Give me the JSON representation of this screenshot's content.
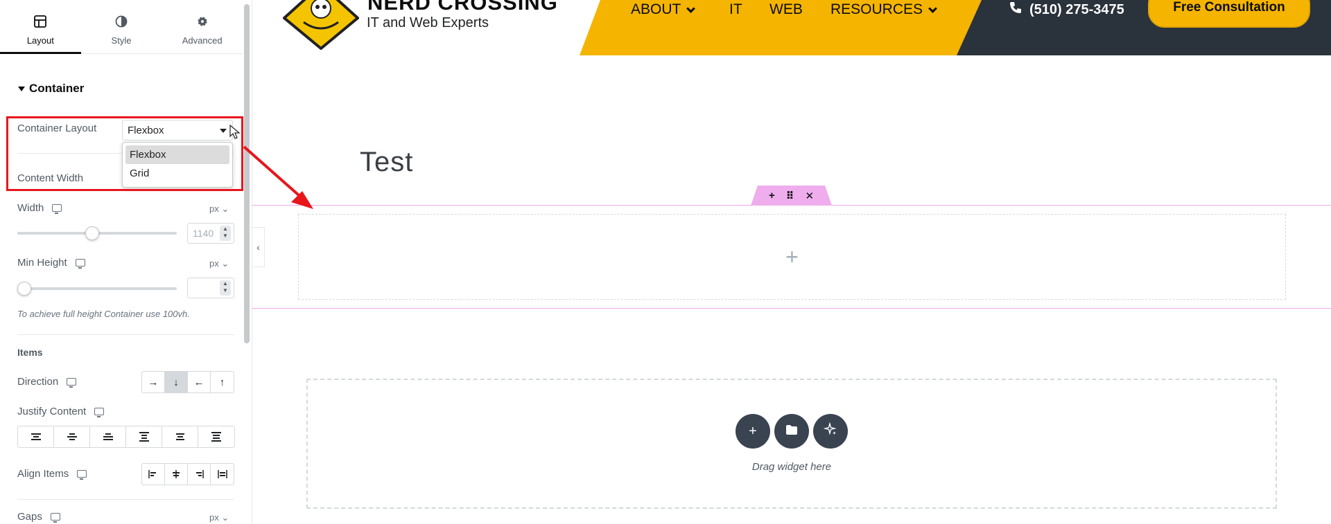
{
  "sidebar": {
    "tabs": [
      {
        "label": "Layout",
        "icon": "layout-icon",
        "active": true
      },
      {
        "label": "Style",
        "icon": "contrast-icon",
        "active": false
      },
      {
        "label": "Advanced",
        "icon": "gear-icon",
        "active": false
      }
    ],
    "section_title": "Container",
    "container_layout": {
      "label": "Container Layout",
      "value": "Flexbox",
      "options": [
        "Flexbox",
        "Grid"
      ],
      "selected_option": "Flexbox"
    },
    "content_width": {
      "label": "Content Width"
    },
    "width": {
      "label": "Width",
      "unit": "px",
      "value": "1140",
      "slider_fraction": 0.47
    },
    "min_height": {
      "label": "Min Height",
      "unit": "px",
      "value": "",
      "slider_fraction": 0.0,
      "hint": "To achieve full height Container use 100vh."
    },
    "items_heading": "Items",
    "direction": {
      "label": "Direction",
      "options": [
        "→",
        "↓",
        "←",
        "↑"
      ],
      "selected_index": 1
    },
    "justify_content": {
      "label": "Justify Content"
    },
    "align_items": {
      "label": "Align Items"
    },
    "gaps": {
      "label": "Gaps",
      "unit": "px"
    }
  },
  "site": {
    "brand": "NERD CROSSING",
    "tagline": "IT and Web Experts",
    "nav": [
      {
        "label": "ABOUT",
        "has_dropdown": true
      },
      {
        "label": "IT",
        "has_dropdown": false
      },
      {
        "label": "WEB",
        "has_dropdown": false
      },
      {
        "label": "RESOURCES",
        "has_dropdown": true
      }
    ],
    "phone": "(510) 275-3475",
    "cta": "Free Consultation",
    "colors": {
      "accent": "#f5b400",
      "dark": "#2a323c",
      "container_outline": "#f3a6f0"
    }
  },
  "canvas": {
    "heading": "Test",
    "drag_hint": "Drag widget here",
    "container_handle_icons": [
      "plus-icon",
      "drag-handle-icon",
      "close-icon"
    ],
    "add_buttons": [
      "plus-icon",
      "folder-icon",
      "ai-sparkle-icon"
    ]
  }
}
